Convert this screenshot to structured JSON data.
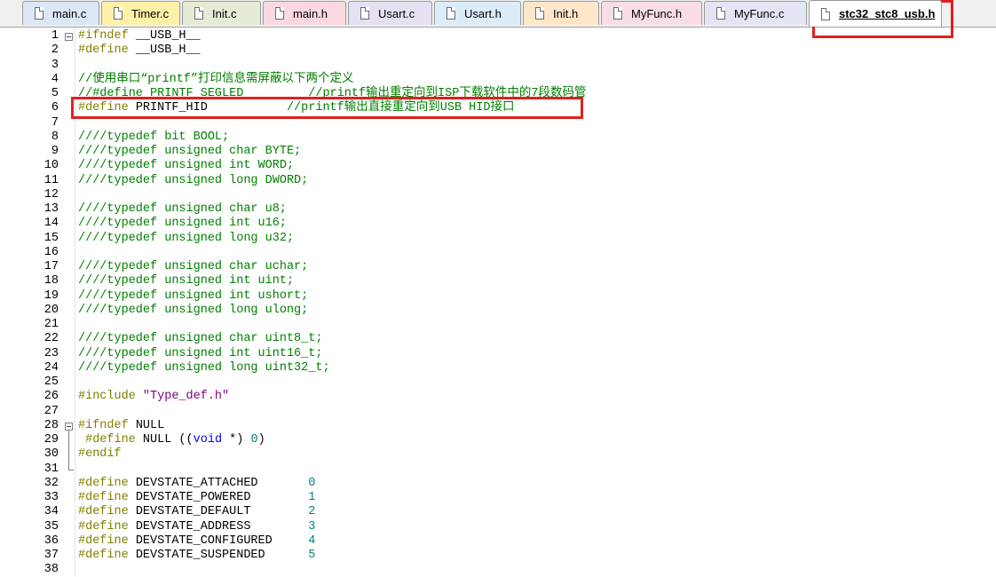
{
  "tabs": [
    {
      "label": "main.c",
      "color": "#dce6f4"
    },
    {
      "label": "Timer.c",
      "color": "#fff1a8"
    },
    {
      "label": "Init.c",
      "color": "#e4ecd6"
    },
    {
      "label": "main.h",
      "color": "#fbd8e0"
    },
    {
      "label": "Usart.c",
      "color": "#e6e0f2"
    },
    {
      "label": "Usart.h",
      "color": "#dcecf8"
    },
    {
      "label": "Init.h",
      "color": "#ffe6c8"
    },
    {
      "label": "MyFunc.h",
      "color": "#f8dde6"
    },
    {
      "label": "MyFunc.c",
      "color": "#e3e4f4"
    },
    {
      "label": "stc32_stc8_usb.h",
      "color": "#ffffff",
      "active": true
    }
  ],
  "highlight_color": "#e02020",
  "code_lines": [
    {
      "n": "1",
      "segs": [
        [
          "pp",
          "#ifndef "
        ],
        [
          "tx",
          "__USB_H__"
        ]
      ]
    },
    {
      "n": "2",
      "segs": [
        [
          "pp",
          "#define "
        ],
        [
          "tx",
          "__USB_H__"
        ]
      ]
    },
    {
      "n": "3",
      "segs": []
    },
    {
      "n": "4",
      "segs": [
        [
          "cm",
          "//使用串口“printf”打印信息需屏蔽以下两个定义"
        ]
      ]
    },
    {
      "n": "5",
      "segs": [
        [
          "cm",
          "//#define PRINTF_SEGLED         //printf输出重定向到ISP下载软件中的7段数码管"
        ]
      ]
    },
    {
      "n": "6",
      "segs": [
        [
          "pp",
          "#define "
        ],
        [
          "tx",
          "PRINTF_HID           "
        ],
        [
          "cm",
          "//printf输出直接重定向到USB HID接口"
        ]
      ]
    },
    {
      "n": "7",
      "segs": []
    },
    {
      "n": "8",
      "segs": [
        [
          "cm",
          "////typedef bit BOOL;"
        ]
      ]
    },
    {
      "n": "9",
      "segs": [
        [
          "cm",
          "////typedef unsigned char BYTE;"
        ]
      ]
    },
    {
      "n": "10",
      "segs": [
        [
          "cm",
          "////typedef unsigned int WORD;"
        ]
      ]
    },
    {
      "n": "11",
      "segs": [
        [
          "cm",
          "////typedef unsigned long DWORD;"
        ]
      ]
    },
    {
      "n": "12",
      "segs": []
    },
    {
      "n": "13",
      "segs": [
        [
          "cm",
          "////typedef unsigned char u8;"
        ]
      ]
    },
    {
      "n": "14",
      "segs": [
        [
          "cm",
          "////typedef unsigned int u16;"
        ]
      ]
    },
    {
      "n": "15",
      "segs": [
        [
          "cm",
          "////typedef unsigned long u32;"
        ]
      ]
    },
    {
      "n": "16",
      "segs": []
    },
    {
      "n": "17",
      "segs": [
        [
          "cm",
          "////typedef unsigned char uchar;"
        ]
      ]
    },
    {
      "n": "18",
      "segs": [
        [
          "cm",
          "////typedef unsigned int uint;"
        ]
      ]
    },
    {
      "n": "19",
      "segs": [
        [
          "cm",
          "////typedef unsigned int ushort;"
        ]
      ]
    },
    {
      "n": "20",
      "segs": [
        [
          "cm",
          "////typedef unsigned long ulong;"
        ]
      ]
    },
    {
      "n": "21",
      "segs": []
    },
    {
      "n": "22",
      "segs": [
        [
          "cm",
          "////typedef unsigned char uint8_t;"
        ]
      ]
    },
    {
      "n": "23",
      "segs": [
        [
          "cm",
          "////typedef unsigned int uint16_t;"
        ]
      ]
    },
    {
      "n": "24",
      "segs": [
        [
          "cm",
          "////typedef unsigned long uint32_t;"
        ]
      ]
    },
    {
      "n": "25",
      "segs": []
    },
    {
      "n": "26",
      "segs": [
        [
          "pp",
          "#include "
        ],
        [
          "st",
          "\"Type_def.h\""
        ]
      ]
    },
    {
      "n": "27",
      "segs": []
    },
    {
      "n": "28",
      "segs": [
        [
          "pp",
          "#ifndef "
        ],
        [
          "tx",
          "NULL"
        ]
      ]
    },
    {
      "n": "29",
      "segs": [
        [
          "tx",
          " "
        ],
        [
          "pp",
          "#define "
        ],
        [
          "tx",
          "NULL (("
        ],
        [
          "kw",
          "void"
        ],
        [
          "tx",
          " *) "
        ],
        [
          "nm",
          "0"
        ],
        [
          "tx",
          ")"
        ]
      ]
    },
    {
      "n": "30",
      "segs": [
        [
          "pp",
          "#endif"
        ]
      ]
    },
    {
      "n": "31",
      "segs": []
    },
    {
      "n": "32",
      "segs": [
        [
          "pp",
          "#define "
        ],
        [
          "tx",
          "DEVSTATE_ATTACHED       "
        ],
        [
          "nm",
          "0"
        ]
      ]
    },
    {
      "n": "33",
      "segs": [
        [
          "pp",
          "#define "
        ],
        [
          "tx",
          "DEVSTATE_POWERED        "
        ],
        [
          "nm",
          "1"
        ]
      ]
    },
    {
      "n": "34",
      "segs": [
        [
          "pp",
          "#define "
        ],
        [
          "tx",
          "DEVSTATE_DEFAULT        "
        ],
        [
          "nm",
          "2"
        ]
      ]
    },
    {
      "n": "35",
      "segs": [
        [
          "pp",
          "#define "
        ],
        [
          "tx",
          "DEVSTATE_ADDRESS        "
        ],
        [
          "nm",
          "3"
        ]
      ]
    },
    {
      "n": "36",
      "segs": [
        [
          "pp",
          "#define "
        ],
        [
          "tx",
          "DEVSTATE_CONFIGURED     "
        ],
        [
          "nm",
          "4"
        ]
      ]
    },
    {
      "n": "37",
      "segs": [
        [
          "pp",
          "#define "
        ],
        [
          "tx",
          "DEVSTATE_SUSPENDED      "
        ],
        [
          "nm",
          "5"
        ]
      ]
    },
    {
      "n": "38",
      "segs": []
    }
  ]
}
